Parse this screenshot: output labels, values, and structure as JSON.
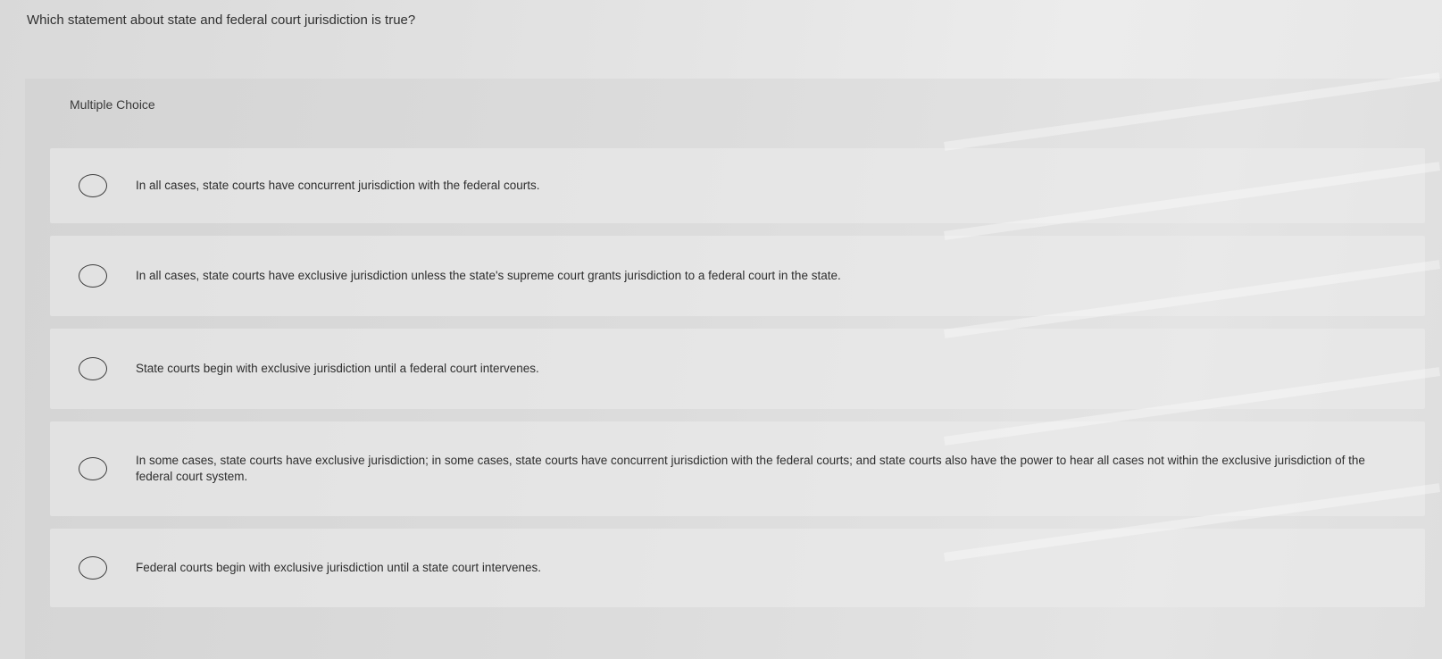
{
  "question": "Which statement about state and federal court jurisdiction is true?",
  "panel_label": "Multiple Choice",
  "options": [
    {
      "label": "In all cases, state courts have concurrent jurisdiction with the federal courts."
    },
    {
      "label": "In all cases, state courts have exclusive jurisdiction unless the state's supreme court grants jurisdiction to a federal court in the state."
    },
    {
      "label": "State courts begin with exclusive jurisdiction until a federal court intervenes."
    },
    {
      "label": "In some cases, state courts have exclusive jurisdiction; in some cases, state courts have concurrent jurisdiction with the federal courts; and state courts also have the power to hear all cases not within the exclusive jurisdiction of the federal court system."
    },
    {
      "label": "Federal courts begin with exclusive jurisdiction until a state court intervenes."
    }
  ]
}
